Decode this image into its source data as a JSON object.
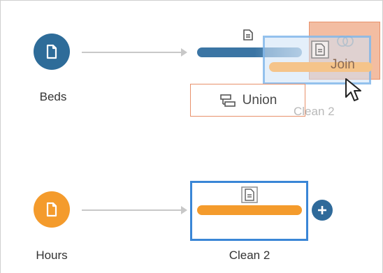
{
  "flow": {
    "input_beds": {
      "label": "Beds",
      "color": "#2e6c99",
      "icon": "file-icon"
    },
    "input_hours": {
      "label": "Hours",
      "color": "#f49b2c",
      "icon": "file-icon"
    },
    "clean_step_top": {
      "color": "#3b75a4",
      "icon": "clean-step-icon"
    },
    "clean_step_bottom": {
      "label": "Clean 2",
      "color": "#f49b2c",
      "icon": "clean-step-icon",
      "selected": true
    },
    "drag_preview": {
      "label": "Clean 2",
      "bar_color": "#f5c48a",
      "icon": "clean-step-icon"
    },
    "drop_targets": {
      "union": {
        "label": "Union",
        "icon": "union-icon"
      },
      "join": {
        "label": "Join",
        "icon": "join-icon"
      }
    },
    "add_button": {
      "icon": "plus-icon",
      "color": "#2f6a9a"
    },
    "cursor": {
      "icon": "mouse-pointer-icon"
    }
  }
}
